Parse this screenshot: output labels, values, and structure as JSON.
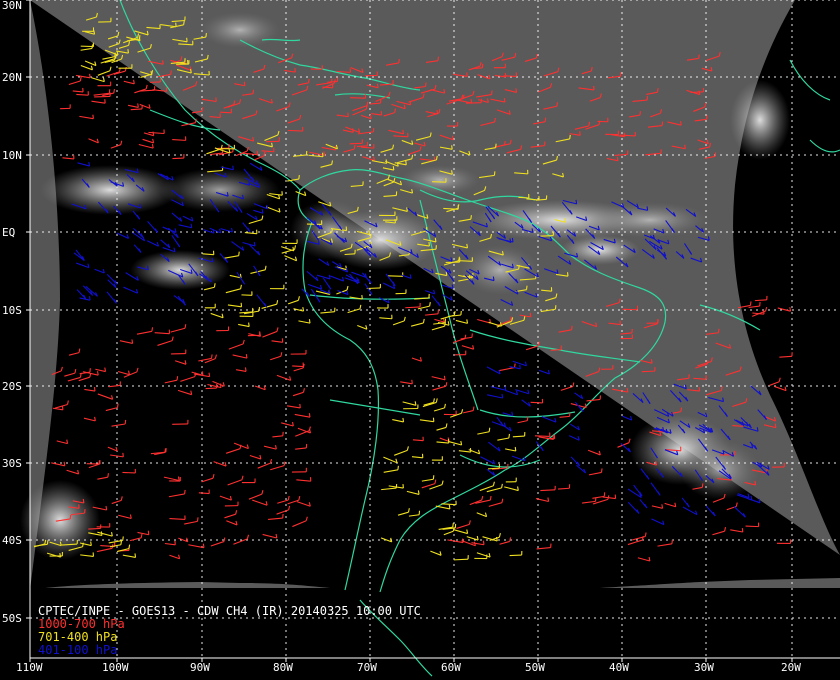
{
  "map": {
    "title": "CPTEC/INPE - GOES13 - CDW CH4 (IR) 20140325 10:00 UTC",
    "legend": [
      {
        "label": "1000-700 hPa",
        "color": "#ff3030"
      },
      {
        "label": "701-400 hPa",
        "color": "#f0e020"
      },
      {
        "label": "401-100 hPa",
        "color": "#1010d0"
      }
    ],
    "lat_labels": [
      "30N",
      "20N",
      "10N",
      "EQ",
      "10S",
      "20S",
      "30S",
      "40S",
      "50S"
    ],
    "lon_labels": [
      "110W",
      "100W",
      "90W",
      "80W",
      "70W",
      "60W",
      "50W",
      "40W",
      "30W",
      "20W"
    ],
    "coastline_color": "#30d8a0",
    "grid_color": "#ffffff"
  }
}
